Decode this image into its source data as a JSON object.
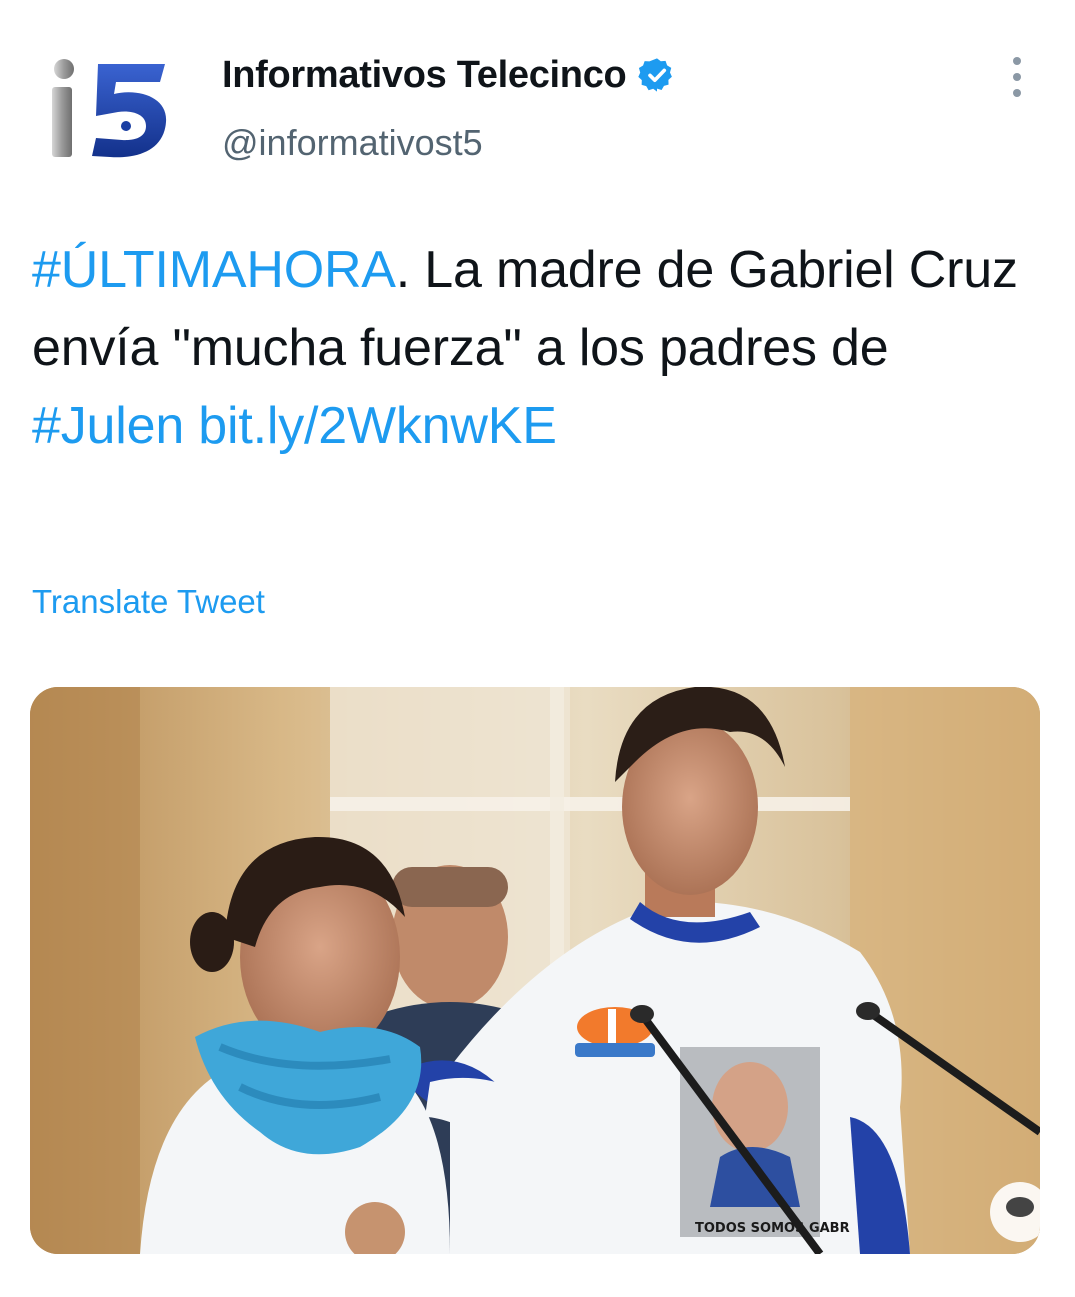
{
  "author": {
    "name": "Informativos Telecinco",
    "handle": "@informativost5",
    "verified_icon": "verified-badge-icon",
    "avatar_icon": "telecinco-logo-icon"
  },
  "tweet": {
    "segments": [
      {
        "text": "#ÚLTIMAHORA",
        "type": "hashtag"
      },
      {
        "text": ". La madre de Gabriel Cruz envía \"mucha fuerza\" a los padres de ",
        "type": "text"
      },
      {
        "text": "#Julen",
        "type": "hashtag"
      },
      {
        "text": " ",
        "type": "text"
      },
      {
        "text": "bit.ly/2WknwKE",
        "type": "link"
      }
    ],
    "translate_label": "Translate Tweet"
  },
  "media": {
    "shirt_text": "TODOS SOMOS GABR"
  },
  "colors": {
    "accent": "#1d9bf0",
    "text": "#0f1419",
    "secondary": "#536471",
    "logo_blue": "#1b3fa3"
  }
}
